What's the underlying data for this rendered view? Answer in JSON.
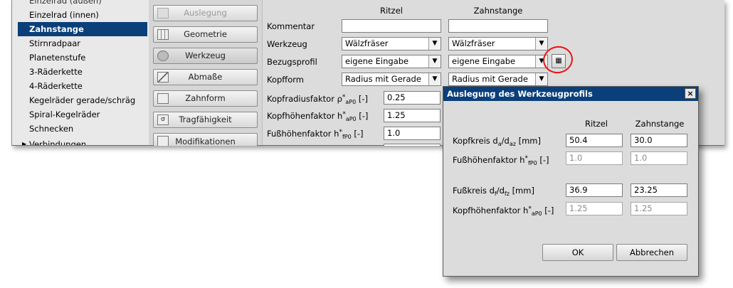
{
  "tree": {
    "items": [
      {
        "label": "Einzelrad (außen)"
      },
      {
        "label": "Einzelrad (innen)"
      },
      {
        "label": "Zahnstange"
      },
      {
        "label": "Stirnradpaar"
      },
      {
        "label": "Planetenstufe"
      },
      {
        "label": "3-Räderkette"
      },
      {
        "label": "4-Räderkette"
      },
      {
        "label": "Kegelräder gerade/schräg"
      },
      {
        "label": "Spiral-Kegelräder"
      },
      {
        "label": "Schnecken"
      },
      {
        "label": "Verbindungen"
      }
    ],
    "selected": "Zahnstange"
  },
  "nav": {
    "auslegung": "Auslegung",
    "geometrie": "Geometrie",
    "werkzeug": "Werkzeug",
    "abmasse": "Abmaße",
    "zahnform": "Zahnform",
    "tragfaehigkeit": "Tragfähigkeit",
    "modifikationen": "Modifikationen"
  },
  "form": {
    "col_ritzel": "Ritzel",
    "col_zahnstange": "Zahnstange",
    "kommentar_label": "Kommentar",
    "kommentar_ritzel": "",
    "kommentar_zahnstange": "",
    "werkzeug_label": "Werkzeug",
    "werkzeug_ritzel": "Wälzfräser",
    "werkzeug_zahnstange": "Wälzfräser",
    "bezugsprofil_label": "Bezugsprofil",
    "bezugsprofil_ritzel": "eigene Eingabe",
    "bezugsprofil_zahnstange": "eigene Eingabe",
    "kopfform_label": "Kopfform",
    "kopfform_ritzel": "Radius mit Gerade",
    "kopfform_zahnstange": "Radius mit Gerade",
    "kopfradiusfaktor_label": "Kopfradiusfaktor ρ",
    "kopfradiusfaktor_sub": "aP0",
    "kopfradiusfaktor_unit": "[-]",
    "kopfradiusfaktor_ritzel": "0.25",
    "kopfhoehenfaktor_label": "Kopfhöhenfaktor h",
    "kopfhoehenfaktor_sub": "aP0",
    "kopfhoehenfaktor_unit": "[-]",
    "kopfhoehenfaktor_ritzel": "1.25",
    "fusshoehenfaktor_label": "Fußhöhenfaktor h",
    "fusshoehenfaktor_sub": "fP0",
    "fusshoehenfaktor_unit": "[-]",
    "fusshoehenfaktor_ritzel": "1.0"
  },
  "dialog": {
    "title": "Auslegung des Werkzeugprofils",
    "close": "×",
    "col_ritzel": "Ritzel",
    "col_zahnstange": "Zahnstange",
    "kopfkreis_label": "Kopfkreis d",
    "kopfkreis_sub1": "a",
    "kopfkreis_sub2": "az",
    "kopfkreis_unit": "[mm]",
    "kopfkreis_ritzel": "50.4",
    "kopfkreis_zahnstange": "30.0",
    "fusshoehen_label": "Fußhöhenfaktor h",
    "fusshoehen_sub": "fP0",
    "fusshoehen_unit": "[-]",
    "fusshoehen_ritzel": "1.0",
    "fusshoehen_zahnstange": "1.0",
    "fusskreis_label": "Fußkreis d",
    "fusskreis_sub1": "f",
    "fusskreis_sub2": "fz",
    "fusskreis_unit": "[mm]",
    "fusskreis_ritzel": "36.9",
    "fusskreis_zahnstange": "23.25",
    "kopfhoehen_label": "Kopfhöhenfaktor h",
    "kopfhoehen_sub": "aP0",
    "kopfhoehen_unit": "[-]",
    "kopfhoehen_ritzel": "1.25",
    "kopfhoehen_zahnstange": "1.25",
    "ok": "OK",
    "cancel": "Abbrechen"
  }
}
